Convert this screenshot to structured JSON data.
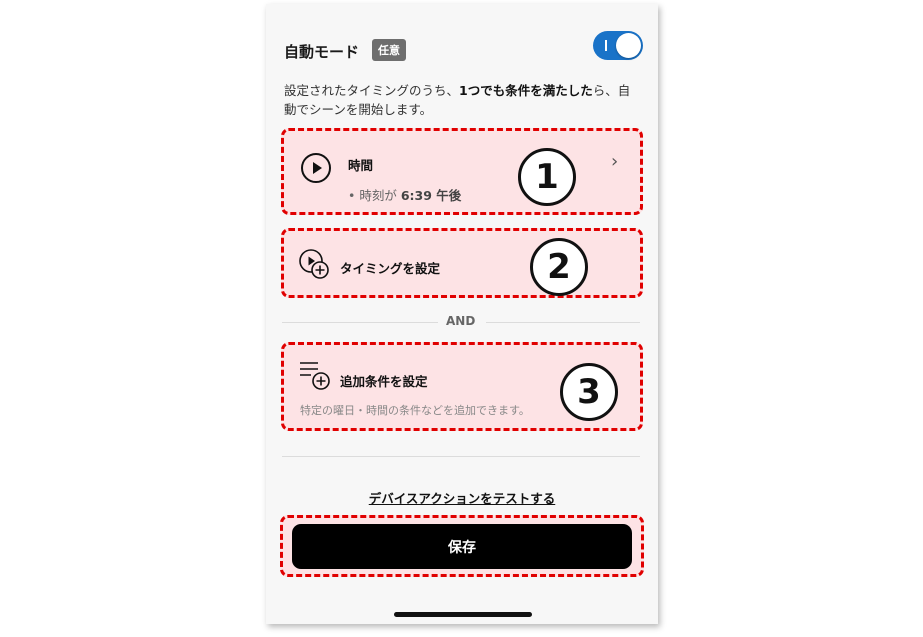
{
  "header": {
    "title": "自動モード",
    "badge": "任意"
  },
  "description": {
    "part1": "設定されたタイミングのうち、",
    "bold": "1つでも条件を満たした",
    "part2": "ら、自動でシーンを開始します。"
  },
  "cards": [
    {
      "number": "1",
      "label": "時間",
      "sub_prefix": "• 時刻が ",
      "sub_value": "6:39 午後",
      "chevron": "›"
    },
    {
      "number": "2",
      "label": "タイミングを設定"
    },
    {
      "number": "3",
      "label": "追加条件を設定",
      "note": "特定の曜日・時間の条件などを追加できます。"
    }
  ],
  "and_label": "AND",
  "test_link": "デバイスアクションをテストする",
  "save_label": "保存",
  "colors": {
    "toggle_on": "#1a73c8",
    "highlight_border": "#e00000",
    "highlight_fill": "#fde3e5",
    "save_button": "#000000"
  },
  "icons": [
    "play-circle-icon",
    "play-add-icon",
    "list-add-icon",
    "chevron-right-icon"
  ]
}
